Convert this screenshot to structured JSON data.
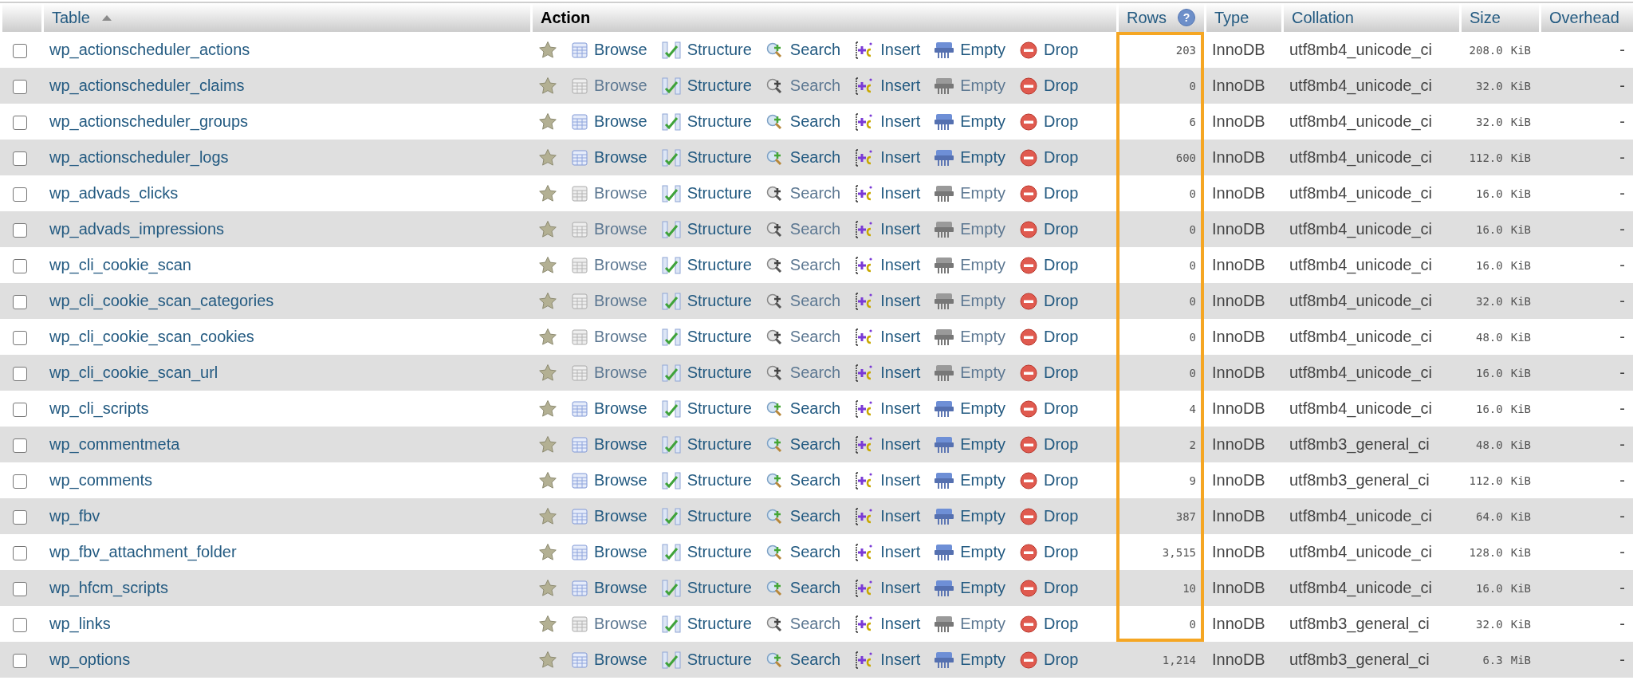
{
  "columns": [
    {
      "kind": "select"
    },
    {
      "kind": "table",
      "label": "Table",
      "sorted": true
    },
    {
      "kind": "action",
      "label": "Action"
    },
    {
      "kind": "rows",
      "label": "Rows",
      "help_icon": "?"
    },
    {
      "kind": "type",
      "label": "Type"
    },
    {
      "kind": "collation",
      "label": "Collation"
    },
    {
      "kind": "size",
      "label": "Size"
    },
    {
      "kind": "overhead",
      "label": "Overhead"
    }
  ],
  "rows": [
    {
      "checked": false,
      "favorite": false,
      "name": "wp_actionscheduler_actions",
      "actions": [
        {
          "kind": "browse",
          "label": "Browse",
          "disabled": false
        },
        {
          "kind": "structure",
          "label": "Structure",
          "disabled": false
        },
        {
          "kind": "search",
          "label": "Search",
          "disabled": false
        },
        {
          "kind": "insert",
          "label": "Insert",
          "disabled": false
        },
        {
          "kind": "empty",
          "label": "Empty",
          "disabled": false
        },
        {
          "kind": "drop",
          "label": "Drop",
          "disabled": false
        }
      ],
      "rows": "203",
      "highlighted": true,
      "type": "InnoDB",
      "collation": "utf8mb4_unicode_ci",
      "size": "208.0",
      "size_unit": "KiB",
      "overhead": "-"
    },
    {
      "checked": false,
      "favorite": false,
      "name": "wp_actionscheduler_claims",
      "actions": [
        {
          "kind": "browse",
          "label": "Browse",
          "disabled": true
        },
        {
          "kind": "structure",
          "label": "Structure",
          "disabled": false
        },
        {
          "kind": "search",
          "label": "Search",
          "disabled": true
        },
        {
          "kind": "insert",
          "label": "Insert",
          "disabled": false
        },
        {
          "kind": "empty",
          "label": "Empty",
          "disabled": true
        },
        {
          "kind": "drop",
          "label": "Drop",
          "disabled": false
        }
      ],
      "rows": "0",
      "highlighted": true,
      "type": "InnoDB",
      "collation": "utf8mb4_unicode_ci",
      "size": "32.0",
      "size_unit": "KiB",
      "overhead": "-"
    },
    {
      "checked": false,
      "favorite": false,
      "name": "wp_actionscheduler_groups",
      "actions": [
        {
          "kind": "browse",
          "label": "Browse",
          "disabled": false
        },
        {
          "kind": "structure",
          "label": "Structure",
          "disabled": false
        },
        {
          "kind": "search",
          "label": "Search",
          "disabled": false
        },
        {
          "kind": "insert",
          "label": "Insert",
          "disabled": false
        },
        {
          "kind": "empty",
          "label": "Empty",
          "disabled": false
        },
        {
          "kind": "drop",
          "label": "Drop",
          "disabled": false
        }
      ],
      "rows": "6",
      "highlighted": true,
      "type": "InnoDB",
      "collation": "utf8mb4_unicode_ci",
      "size": "32.0",
      "size_unit": "KiB",
      "overhead": "-"
    },
    {
      "checked": false,
      "favorite": false,
      "name": "wp_actionscheduler_logs",
      "actions": [
        {
          "kind": "browse",
          "label": "Browse",
          "disabled": false
        },
        {
          "kind": "structure",
          "label": "Structure",
          "disabled": false
        },
        {
          "kind": "search",
          "label": "Search",
          "disabled": false
        },
        {
          "kind": "insert",
          "label": "Insert",
          "disabled": false
        },
        {
          "kind": "empty",
          "label": "Empty",
          "disabled": false
        },
        {
          "kind": "drop",
          "label": "Drop",
          "disabled": false
        }
      ],
      "rows": "600",
      "highlighted": true,
      "type": "InnoDB",
      "collation": "utf8mb4_unicode_ci",
      "size": "112.0",
      "size_unit": "KiB",
      "overhead": "-"
    },
    {
      "checked": false,
      "favorite": false,
      "name": "wp_advads_clicks",
      "actions": [
        {
          "kind": "browse",
          "label": "Browse",
          "disabled": true
        },
        {
          "kind": "structure",
          "label": "Structure",
          "disabled": false
        },
        {
          "kind": "search",
          "label": "Search",
          "disabled": true
        },
        {
          "kind": "insert",
          "label": "Insert",
          "disabled": false
        },
        {
          "kind": "empty",
          "label": "Empty",
          "disabled": true
        },
        {
          "kind": "drop",
          "label": "Drop",
          "disabled": false
        }
      ],
      "rows": "0",
      "highlighted": true,
      "type": "InnoDB",
      "collation": "utf8mb4_unicode_ci",
      "size": "16.0",
      "size_unit": "KiB",
      "overhead": "-"
    },
    {
      "checked": false,
      "favorite": false,
      "name": "wp_advads_impressions",
      "actions": [
        {
          "kind": "browse",
          "label": "Browse",
          "disabled": true
        },
        {
          "kind": "structure",
          "label": "Structure",
          "disabled": false
        },
        {
          "kind": "search",
          "label": "Search",
          "disabled": true
        },
        {
          "kind": "insert",
          "label": "Insert",
          "disabled": false
        },
        {
          "kind": "empty",
          "label": "Empty",
          "disabled": true
        },
        {
          "kind": "drop",
          "label": "Drop",
          "disabled": false
        }
      ],
      "rows": "0",
      "highlighted": true,
      "type": "InnoDB",
      "collation": "utf8mb4_unicode_ci",
      "size": "16.0",
      "size_unit": "KiB",
      "overhead": "-"
    },
    {
      "checked": false,
      "favorite": false,
      "name": "wp_cli_cookie_scan",
      "actions": [
        {
          "kind": "browse",
          "label": "Browse",
          "disabled": true
        },
        {
          "kind": "structure",
          "label": "Structure",
          "disabled": false
        },
        {
          "kind": "search",
          "label": "Search",
          "disabled": true
        },
        {
          "kind": "insert",
          "label": "Insert",
          "disabled": false
        },
        {
          "kind": "empty",
          "label": "Empty",
          "disabled": true
        },
        {
          "kind": "drop",
          "label": "Drop",
          "disabled": false
        }
      ],
      "rows": "0",
      "highlighted": true,
      "type": "InnoDB",
      "collation": "utf8mb4_unicode_ci",
      "size": "16.0",
      "size_unit": "KiB",
      "overhead": "-"
    },
    {
      "checked": false,
      "favorite": false,
      "name": "wp_cli_cookie_scan_categories",
      "actions": [
        {
          "kind": "browse",
          "label": "Browse",
          "disabled": true
        },
        {
          "kind": "structure",
          "label": "Structure",
          "disabled": false
        },
        {
          "kind": "search",
          "label": "Search",
          "disabled": true
        },
        {
          "kind": "insert",
          "label": "Insert",
          "disabled": false
        },
        {
          "kind": "empty",
          "label": "Empty",
          "disabled": true
        },
        {
          "kind": "drop",
          "label": "Drop",
          "disabled": false
        }
      ],
      "rows": "0",
      "highlighted": true,
      "type": "InnoDB",
      "collation": "utf8mb4_unicode_ci",
      "size": "32.0",
      "size_unit": "KiB",
      "overhead": "-"
    },
    {
      "checked": false,
      "favorite": false,
      "name": "wp_cli_cookie_scan_cookies",
      "actions": [
        {
          "kind": "browse",
          "label": "Browse",
          "disabled": true
        },
        {
          "kind": "structure",
          "label": "Structure",
          "disabled": false
        },
        {
          "kind": "search",
          "label": "Search",
          "disabled": true
        },
        {
          "kind": "insert",
          "label": "Insert",
          "disabled": false
        },
        {
          "kind": "empty",
          "label": "Empty",
          "disabled": true
        },
        {
          "kind": "drop",
          "label": "Drop",
          "disabled": false
        }
      ],
      "rows": "0",
      "highlighted": true,
      "type": "InnoDB",
      "collation": "utf8mb4_unicode_ci",
      "size": "48.0",
      "size_unit": "KiB",
      "overhead": "-"
    },
    {
      "checked": false,
      "favorite": false,
      "name": "wp_cli_cookie_scan_url",
      "actions": [
        {
          "kind": "browse",
          "label": "Browse",
          "disabled": true
        },
        {
          "kind": "structure",
          "label": "Structure",
          "disabled": false
        },
        {
          "kind": "search",
          "label": "Search",
          "disabled": true
        },
        {
          "kind": "insert",
          "label": "Insert",
          "disabled": false
        },
        {
          "kind": "empty",
          "label": "Empty",
          "disabled": true
        },
        {
          "kind": "drop",
          "label": "Drop",
          "disabled": false
        }
      ],
      "rows": "0",
      "highlighted": true,
      "type": "InnoDB",
      "collation": "utf8mb4_unicode_ci",
      "size": "16.0",
      "size_unit": "KiB",
      "overhead": "-"
    },
    {
      "checked": false,
      "favorite": false,
      "name": "wp_cli_scripts",
      "actions": [
        {
          "kind": "browse",
          "label": "Browse",
          "disabled": false
        },
        {
          "kind": "structure",
          "label": "Structure",
          "disabled": false
        },
        {
          "kind": "search",
          "label": "Search",
          "disabled": false
        },
        {
          "kind": "insert",
          "label": "Insert",
          "disabled": false
        },
        {
          "kind": "empty",
          "label": "Empty",
          "disabled": false
        },
        {
          "kind": "drop",
          "label": "Drop",
          "disabled": false
        }
      ],
      "rows": "4",
      "highlighted": true,
      "type": "InnoDB",
      "collation": "utf8mb4_unicode_ci",
      "size": "16.0",
      "size_unit": "KiB",
      "overhead": "-"
    },
    {
      "checked": false,
      "favorite": false,
      "name": "wp_commentmeta",
      "actions": [
        {
          "kind": "browse",
          "label": "Browse",
          "disabled": false
        },
        {
          "kind": "structure",
          "label": "Structure",
          "disabled": false
        },
        {
          "kind": "search",
          "label": "Search",
          "disabled": false
        },
        {
          "kind": "insert",
          "label": "Insert",
          "disabled": false
        },
        {
          "kind": "empty",
          "label": "Empty",
          "disabled": false
        },
        {
          "kind": "drop",
          "label": "Drop",
          "disabled": false
        }
      ],
      "rows": "2",
      "highlighted": true,
      "type": "InnoDB",
      "collation": "utf8mb3_general_ci",
      "size": "48.0",
      "size_unit": "KiB",
      "overhead": "-"
    },
    {
      "checked": false,
      "favorite": false,
      "name": "wp_comments",
      "actions": [
        {
          "kind": "browse",
          "label": "Browse",
          "disabled": false
        },
        {
          "kind": "structure",
          "label": "Structure",
          "disabled": false
        },
        {
          "kind": "search",
          "label": "Search",
          "disabled": false
        },
        {
          "kind": "insert",
          "label": "Insert",
          "disabled": false
        },
        {
          "kind": "empty",
          "label": "Empty",
          "disabled": false
        },
        {
          "kind": "drop",
          "label": "Drop",
          "disabled": false
        }
      ],
      "rows": "9",
      "highlighted": true,
      "type": "InnoDB",
      "collation": "utf8mb3_general_ci",
      "size": "112.0",
      "size_unit": "KiB",
      "overhead": "-"
    },
    {
      "checked": false,
      "favorite": false,
      "name": "wp_fbv",
      "actions": [
        {
          "kind": "browse",
          "label": "Browse",
          "disabled": false
        },
        {
          "kind": "structure",
          "label": "Structure",
          "disabled": false
        },
        {
          "kind": "search",
          "label": "Search",
          "disabled": false
        },
        {
          "kind": "insert",
          "label": "Insert",
          "disabled": false
        },
        {
          "kind": "empty",
          "label": "Empty",
          "disabled": false
        },
        {
          "kind": "drop",
          "label": "Drop",
          "disabled": false
        }
      ],
      "rows": "387",
      "highlighted": true,
      "type": "InnoDB",
      "collation": "utf8mb4_unicode_ci",
      "size": "64.0",
      "size_unit": "KiB",
      "overhead": "-"
    },
    {
      "checked": false,
      "favorite": false,
      "name": "wp_fbv_attachment_folder",
      "actions": [
        {
          "kind": "browse",
          "label": "Browse",
          "disabled": false
        },
        {
          "kind": "structure",
          "label": "Structure",
          "disabled": false
        },
        {
          "kind": "search",
          "label": "Search",
          "disabled": false
        },
        {
          "kind": "insert",
          "label": "Insert",
          "disabled": false
        },
        {
          "kind": "empty",
          "label": "Empty",
          "disabled": false
        },
        {
          "kind": "drop",
          "label": "Drop",
          "disabled": false
        }
      ],
      "rows": "3,515",
      "highlighted": true,
      "type": "InnoDB",
      "collation": "utf8mb4_unicode_ci",
      "size": "128.0",
      "size_unit": "KiB",
      "overhead": "-"
    },
    {
      "checked": false,
      "favorite": false,
      "name": "wp_hfcm_scripts",
      "actions": [
        {
          "kind": "browse",
          "label": "Browse",
          "disabled": false
        },
        {
          "kind": "structure",
          "label": "Structure",
          "disabled": false
        },
        {
          "kind": "search",
          "label": "Search",
          "disabled": false
        },
        {
          "kind": "insert",
          "label": "Insert",
          "disabled": false
        },
        {
          "kind": "empty",
          "label": "Empty",
          "disabled": false
        },
        {
          "kind": "drop",
          "label": "Drop",
          "disabled": false
        }
      ],
      "rows": "10",
      "highlighted": true,
      "type": "InnoDB",
      "collation": "utf8mb4_unicode_ci",
      "size": "16.0",
      "size_unit": "KiB",
      "overhead": "-"
    },
    {
      "checked": false,
      "favorite": false,
      "name": "wp_links",
      "actions": [
        {
          "kind": "browse",
          "label": "Browse",
          "disabled": true
        },
        {
          "kind": "structure",
          "label": "Structure",
          "disabled": false
        },
        {
          "kind": "search",
          "label": "Search",
          "disabled": true
        },
        {
          "kind": "insert",
          "label": "Insert",
          "disabled": false
        },
        {
          "kind": "empty",
          "label": "Empty",
          "disabled": true
        },
        {
          "kind": "drop",
          "label": "Drop",
          "disabled": false
        }
      ],
      "rows": "0",
      "highlighted": true,
      "type": "InnoDB",
      "collation": "utf8mb3_general_ci",
      "size": "32.0",
      "size_unit": "KiB",
      "overhead": "-"
    },
    {
      "checked": false,
      "favorite": false,
      "name": "wp_options",
      "actions": [
        {
          "kind": "browse",
          "label": "Browse",
          "disabled": false
        },
        {
          "kind": "structure",
          "label": "Structure",
          "disabled": false
        },
        {
          "kind": "search",
          "label": "Search",
          "disabled": false
        },
        {
          "kind": "insert",
          "label": "Insert",
          "disabled": false
        },
        {
          "kind": "empty",
          "label": "Empty",
          "disabled": false
        },
        {
          "kind": "drop",
          "label": "Drop",
          "disabled": false
        }
      ],
      "rows": "1,214",
      "highlighted": false,
      "type": "InnoDB",
      "collation": "utf8mb3_general_ci",
      "size": "6.3",
      "size_unit": "MiB",
      "overhead": "-"
    }
  ]
}
